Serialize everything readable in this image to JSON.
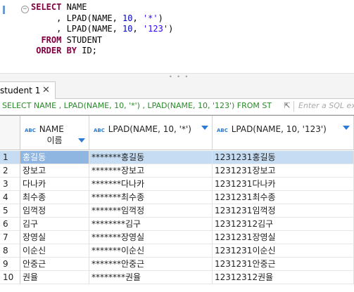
{
  "editor": {
    "lines": [
      {
        "parts": [
          {
            "t": "SELECT",
            "c": "kw"
          },
          {
            "t": " NAME",
            "c": ""
          }
        ]
      },
      {
        "parts": [
          {
            "t": "     , LPAD(NAME, ",
            "c": ""
          },
          {
            "t": "10",
            "c": "num"
          },
          {
            "t": ", ",
            "c": ""
          },
          {
            "t": "'*'",
            "c": "str"
          },
          {
            "t": ")",
            "c": ""
          }
        ]
      },
      {
        "parts": [
          {
            "t": "     , LPAD(NAME, ",
            "c": ""
          },
          {
            "t": "10",
            "c": "num"
          },
          {
            "t": ", ",
            "c": ""
          },
          {
            "t": "'123'",
            "c": "str"
          },
          {
            "t": ")",
            "c": ""
          }
        ]
      },
      {
        "parts": [
          {
            "t": "  FROM",
            "c": "kw"
          },
          {
            "t": " STUDENT",
            "c": ""
          }
        ]
      },
      {
        "parts": [
          {
            "t": " ORDER BY",
            "c": "kw"
          },
          {
            "t": " ID;",
            "c": ""
          }
        ]
      }
    ]
  },
  "result_tab": {
    "label": "student 1",
    "close": "✕"
  },
  "filter": {
    "query": "SELECT NAME , LPAD(NAME, 10, '*') , LPAD(NAME, 10, '123') FROM ST",
    "placeholder": "Enter a SQL ex"
  },
  "columns": [
    {
      "badge": "ABC",
      "label": "NAME",
      "sub": "이름"
    },
    {
      "badge": "ABC",
      "label": "LPAD(NAME, 10, '*')",
      "sub": ""
    },
    {
      "badge": "ABC",
      "label": "LPAD(NAME, 10, '123')",
      "sub": ""
    }
  ],
  "rows": [
    {
      "n": "1",
      "c": [
        "홍길동",
        "*******홍길동",
        "1231231홍길동"
      ]
    },
    {
      "n": "2",
      "c": [
        "장보고",
        "*******장보고",
        "1231231장보고"
      ]
    },
    {
      "n": "3",
      "c": [
        "다나카",
        "*******다나카",
        "1231231다나카"
      ]
    },
    {
      "n": "4",
      "c": [
        "최수종",
        "*******최수종",
        "1231231최수종"
      ]
    },
    {
      "n": "5",
      "c": [
        "임꺽정",
        "*******임꺽정",
        "1231231임꺽정"
      ]
    },
    {
      "n": "6",
      "c": [
        "김구",
        "********김구",
        "12312312김구"
      ]
    },
    {
      "n": "7",
      "c": [
        "장영실",
        "*******장영실",
        "1231231장영실"
      ]
    },
    {
      "n": "8",
      "c": [
        "이순신",
        "*******이순신",
        "1231231이순신"
      ]
    },
    {
      "n": "9",
      "c": [
        "안중근",
        "*******안중근",
        "1231231안중근"
      ]
    },
    {
      "n": "10",
      "c": [
        "권율",
        "********권율",
        "12312312권율"
      ]
    }
  ],
  "selected_row": 0,
  "colors": {
    "selection": "#c6dcf2",
    "selected_cell": "#8fb6e0",
    "keyword": "#800040",
    "string": "#2a00ff",
    "number": "#0000c0",
    "filter_text": "#2a8a2a"
  }
}
